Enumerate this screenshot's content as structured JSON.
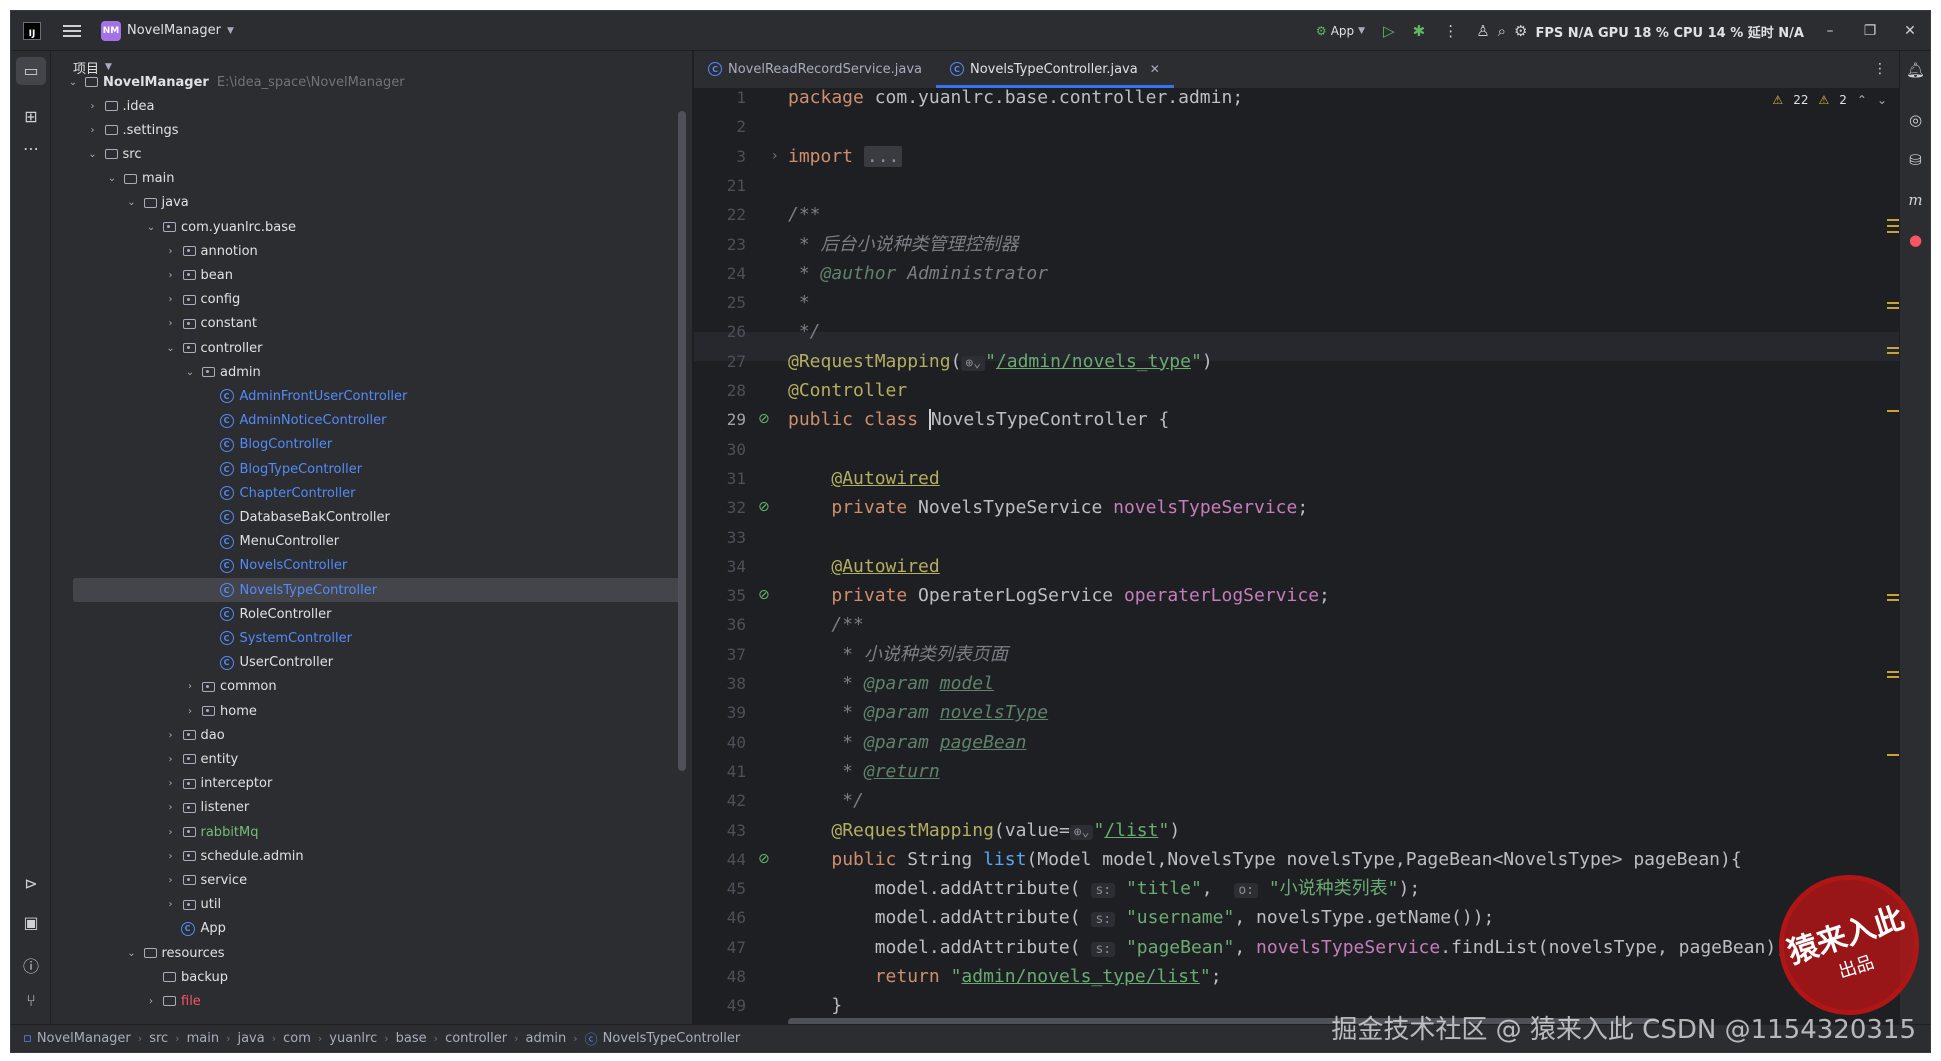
{
  "titlebar": {
    "project_badge": "NM",
    "project_name": "NovelManager",
    "run_config": "App",
    "perf": "FPS  N/A  GPU  18 % CPU  14 % 延时  N/A"
  },
  "project_panel": {
    "title": "项目",
    "root_name": "NovelManager",
    "root_path": "E:\\idea_space\\NovelManager",
    "tree": [
      {
        "label": ".idea",
        "level": 1,
        "kind": "folder",
        "open": false
      },
      {
        "label": ".settings",
        "level": 1,
        "kind": "folder",
        "open": false
      },
      {
        "label": "src",
        "level": 1,
        "kind": "folder",
        "open": true
      },
      {
        "label": "main",
        "level": 2,
        "kind": "folder",
        "open": true
      },
      {
        "label": "java",
        "level": 3,
        "kind": "folder",
        "open": true
      },
      {
        "label": "com.yuanlrc.base",
        "level": 4,
        "kind": "pkg",
        "open": true
      },
      {
        "label": "annotion",
        "level": 5,
        "kind": "pkg",
        "open": false
      },
      {
        "label": "bean",
        "level": 5,
        "kind": "pkg",
        "open": false
      },
      {
        "label": "config",
        "level": 5,
        "kind": "pkg",
        "open": false
      },
      {
        "label": "constant",
        "level": 5,
        "kind": "pkg",
        "open": false
      },
      {
        "label": "controller",
        "level": 5,
        "kind": "pkg",
        "open": true
      },
      {
        "label": "admin",
        "level": 6,
        "kind": "pkg",
        "open": true
      },
      {
        "label": "AdminFrontUserController",
        "level": 7,
        "kind": "class",
        "color": "blue"
      },
      {
        "label": "AdminNoticeController",
        "level": 7,
        "kind": "class",
        "color": "blue"
      },
      {
        "label": "BlogController",
        "level": 7,
        "kind": "class",
        "color": "blue"
      },
      {
        "label": "BlogTypeController",
        "level": 7,
        "kind": "class",
        "color": "blue"
      },
      {
        "label": "ChapterController",
        "level": 7,
        "kind": "class",
        "color": "blue"
      },
      {
        "label": "DatabaseBakController",
        "level": 7,
        "kind": "class"
      },
      {
        "label": "MenuController",
        "level": 7,
        "kind": "class"
      },
      {
        "label": "NovelsController",
        "level": 7,
        "kind": "class",
        "color": "blue"
      },
      {
        "label": "NovelsTypeController",
        "level": 7,
        "kind": "class",
        "color": "blue",
        "selected": true
      },
      {
        "label": "RoleController",
        "level": 7,
        "kind": "class"
      },
      {
        "label": "SystemController",
        "level": 7,
        "kind": "class",
        "color": "blue"
      },
      {
        "label": "UserController",
        "level": 7,
        "kind": "class"
      },
      {
        "label": "common",
        "level": 6,
        "kind": "pkg",
        "open": false
      },
      {
        "label": "home",
        "level": 6,
        "kind": "pkg",
        "open": false
      },
      {
        "label": "dao",
        "level": 5,
        "kind": "pkg",
        "open": false
      },
      {
        "label": "entity",
        "level": 5,
        "kind": "pkg",
        "open": false
      },
      {
        "label": "interceptor",
        "level": 5,
        "kind": "pkg",
        "open": false
      },
      {
        "label": "listener",
        "level": 5,
        "kind": "pkg",
        "open": false
      },
      {
        "label": "rabbitMq",
        "level": 5,
        "kind": "pkg",
        "open": false,
        "color": "green"
      },
      {
        "label": "schedule.admin",
        "level": 5,
        "kind": "pkg",
        "open": false
      },
      {
        "label": "service",
        "level": 5,
        "kind": "pkg",
        "open": false
      },
      {
        "label": "util",
        "level": 5,
        "kind": "pkg",
        "open": false
      },
      {
        "label": "App",
        "level": 5,
        "kind": "class"
      },
      {
        "label": "resources",
        "level": 3,
        "kind": "folder",
        "open": true
      },
      {
        "label": "backup",
        "level": 4,
        "kind": "folder",
        "leaf": true
      },
      {
        "label": "file",
        "level": 4,
        "kind": "folder",
        "open": false,
        "color": "red"
      }
    ]
  },
  "tabs": [
    {
      "label": "NovelReadRecordService.java",
      "active": false
    },
    {
      "label": "NovelsTypeController.java",
      "active": true
    }
  ],
  "editor": {
    "warnings": "22",
    "weak_warnings": "2",
    "lines": [
      {
        "n": "1",
        "html": "<span class='kw'>package</span> com.yuanlrc.base.controller.admin;"
      },
      {
        "n": "2",
        "html": ""
      },
      {
        "n": "3",
        "html": "<span class='kw'>import</span> <span class='fold-box'>...</span>"
      },
      {
        "n": "21",
        "html": ""
      },
      {
        "n": "22",
        "html": "<span class='cm'>/**</span>"
      },
      {
        "n": "23",
        "html": "<span class='cm'> * 后台小说种类管理控制器</span>"
      },
      {
        "n": "24",
        "html": "<span class='cm'> * </span><span class='tag'>@author</span><span class='cm'> Administrator</span>"
      },
      {
        "n": "25",
        "html": "<span class='cm'> *</span>"
      },
      {
        "n": "26",
        "html": "<span class='cm'> */</span>"
      },
      {
        "n": "27",
        "html": "<span class='ann'>@RequestMapping</span>(<span class='hint'>⊕⌄</span><span class='str'>\"<span class='ul'>/admin/novels_type</span>\"</span>)"
      },
      {
        "n": "28",
        "html": "<span class='ann'>@Controller</span>"
      },
      {
        "n": "29",
        "html": "<span class='kw'>public class</span> <span class='caret'></span>NovelsTypeController {"
      },
      {
        "n": "30",
        "html": ""
      },
      {
        "n": "31",
        "html": "    <span class='ann ul'>@Autowired</span>"
      },
      {
        "n": "32",
        "html": "    <span class='kw'>private</span> NovelsTypeService <span class='fld'>novelsTypeService</span>;"
      },
      {
        "n": "33",
        "html": ""
      },
      {
        "n": "34",
        "html": "    <span class='ann ul'>@Autowired</span>"
      },
      {
        "n": "35",
        "html": "    <span class='kw'>private</span> OperaterLogService <span class='fld'>operaterLogService</span>;"
      },
      {
        "n": "36",
        "html": "    <span class='cm'>/**</span>"
      },
      {
        "n": "37",
        "html": "<span class='cm'>     * 小说种类列表页面</span>"
      },
      {
        "n": "38",
        "html": "<span class='cm'>     * </span><span class='tag'>@param</span> <span class='tag ul'>model</span>"
      },
      {
        "n": "39",
        "html": "<span class='cm'>     * </span><span class='tag'>@param</span> <span class='tag ul'>novelsType</span>"
      },
      {
        "n": "40",
        "html": "<span class='cm'>     * </span><span class='tag'>@param</span> <span class='tag ul'>pageBean</span>"
      },
      {
        "n": "41",
        "html": "<span class='cm'>     * </span><span class='tag ul'>@return</span>"
      },
      {
        "n": "42",
        "html": "<span class='cm'>     */</span>"
      },
      {
        "n": "43",
        "html": "    <span class='ann'>@RequestMapping</span>(value=<span class='hint'>⊕⌄</span><span class='str'>\"<span class='ul'>/list</span>\"</span>)"
      },
      {
        "n": "44",
        "html": "    <span class='kw'>public</span> String <span class='mth'>list</span>(Model model,NovelsType novelsType,PageBean&lt;NovelsType&gt; pageBean){"
      },
      {
        "n": "45",
        "html": "        model.addAttribute( <span class='hint'>s:</span> <span class='str'>\"title\"</span>,  <span class='hint'>o:</span> <span class='str'>\"小说种类列表\"</span>);"
      },
      {
        "n": "46",
        "html": "        model.addAttribute( <span class='hint'>s:</span> <span class='str'>\"username\"</span>, novelsType.getName());"
      },
      {
        "n": "47",
        "html": "        model.addAttribute( <span class='hint'>s:</span> <span class='str'>\"pageBean\"</span>, <span class='fld'>novelsTypeService</span>.findList(novelsType, pageBean));"
      },
      {
        "n": "48",
        "html": "        <span class='kw'>return</span> <span class='str'>\"<span class='ul'>admin/novels_type/list</span>\"</span>;"
      },
      {
        "n": "49",
        "html": "    }"
      }
    ]
  },
  "statusbar": {
    "breadcrumbs": [
      "NovelManager",
      "src",
      "main",
      "java",
      "com",
      "yuanlrc",
      "base",
      "controller",
      "admin",
      "NovelsTypeController"
    ]
  },
  "watermark": {
    "text": "掘金技术社区 @ 猿来入此   CSDN @1154320315",
    "seal_main": "猿来入此",
    "seal_sub": "出品"
  }
}
